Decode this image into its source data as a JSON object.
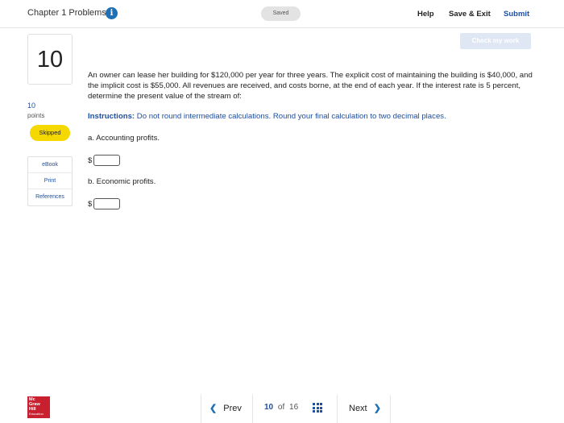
{
  "header": {
    "title": "Chapter 1 Problems",
    "saved_label": "Saved",
    "help_label": "Help",
    "save_exit_label": "Save & Exit",
    "submit_label": "Submit"
  },
  "check_my_work_label": "Check my work",
  "question": {
    "number": "10",
    "points_value": "10",
    "points_label": "points",
    "status_badge": "Skipped",
    "text": "An owner can lease her building for $120,000 per year for three years.  The explicit cost of maintaining the building is $40,000, and the implicit cost is $55,000.  All revenues are received, and costs borne, at the end of each year.  If the interest rate is 5 percent, determine the present value of the stream of:",
    "instructions_label": "Instructions:",
    "instructions_text": " Do not round intermediate calculations. Round your final calculation to two decimal places.",
    "parts": [
      {
        "label": "a. Accounting profits.",
        "currency": "$",
        "value": ""
      },
      {
        "label": "b. Economic profits.",
        "currency": "$",
        "value": ""
      }
    ]
  },
  "side_links": [
    {
      "label": "eBook"
    },
    {
      "label": "Print"
    },
    {
      "label": "References"
    }
  ],
  "footer": {
    "logo_lines": [
      "Mc",
      "Graw",
      "Hill",
      "Education"
    ],
    "prev_label": "Prev",
    "current_page": "10",
    "of_label": "of",
    "total_pages": "16",
    "next_label": "Next"
  },
  "colors": {
    "accent": "#1f4fa0",
    "skipped": "#f5d800",
    "brand_red": "#c8202f"
  }
}
